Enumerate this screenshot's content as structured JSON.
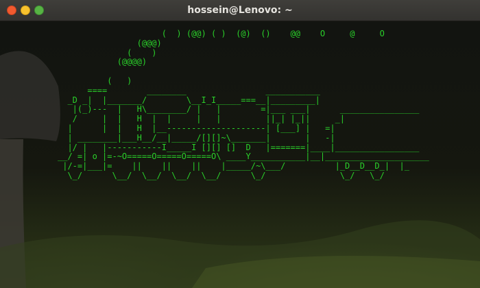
{
  "window": {
    "title": "hossein@Lenovo: ~",
    "controls": [
      "close",
      "minimize",
      "maximize"
    ]
  },
  "terminal": {
    "text_color": "#2ad12a",
    "lines": [
      "                     (  ) (@@) ( )  (@)  ()    @@    O     @     O",
      "                (@@@)",
      "              (    )",
      "            (@@@@)",
      "",
      "          (   )",
      "      ====        ________                ___________",
      "  _D _|  |_______/        \\__I_I_____===__|_________|",
      "   |(_)---  |   H\\________/ |   |        =|___ ___|      ________________",
      "   /     |  |   H  |  |     |   |         ||_| |_||     _|",
      "  |      |  |   H  |__--------------------| [___] |   =|",
      "  | ________|___H__/__|_____/[][]~\\_______|       |   -|",
      "  |/ |   |-----------I_____I [][] []  D   |=======|____|_________________",
      "__/ =| o |=-~O=====O=====O=====O\\ ____Y___________|__|_____________________",
      " |/-=|___|=    ||    ||    ||    |_____/~\\___/          |_D__D__D_|  |_",
      "  \\_/      \\__/  \\__/  \\__/  \\__/      \\_/               \\_/   \\_/"
    ]
  }
}
